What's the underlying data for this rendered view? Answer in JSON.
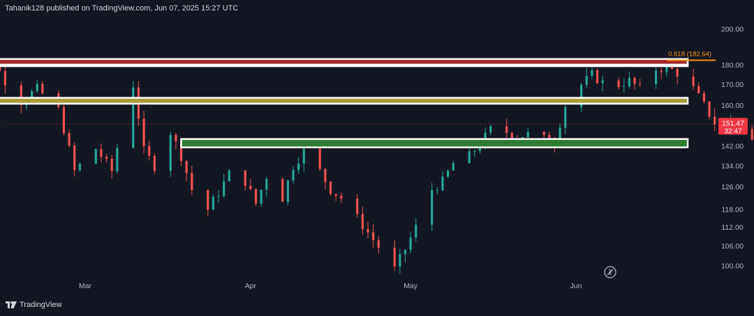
{
  "header": {
    "publisher_line": "Tahanik128 published on TradingView.com, Jun 07, 2025 15:27 UTC"
  },
  "footer": {
    "brand": "TradingView"
  },
  "colors": {
    "background": "#131722",
    "up": "#26a69a",
    "down": "#ef5350",
    "text": "#b2b5be",
    "fib": "#f7931a",
    "red_zone": "#a3282e",
    "orange_zone": "#e6a94a",
    "yellow_zone": "#a89c3a",
    "green_zone": "#2e7d32",
    "zone_border": "#ffffff",
    "price_badge": "#f23645"
  },
  "chart_data": {
    "type": "candlestick",
    "x_axis": {
      "labels": [
        {
          "label": "Mar",
          "date": "2025-03-01"
        },
        {
          "label": "Apr",
          "date": "2025-04-01"
        },
        {
          "label": "May",
          "date": "2025-05-01"
        },
        {
          "label": "Jun",
          "date": "2025-06-01"
        }
      ],
      "range": [
        "2025-02-05",
        "2025-06-06"
      ]
    },
    "y_axis": {
      "scale": "log",
      "ticks": [
        200,
        180,
        170,
        160,
        151.47,
        142,
        134,
        126,
        118,
        112,
        106,
        100
      ],
      "tick_labels": [
        "200.00",
        "180.00",
        "170.00",
        "160.00",
        "",
        "142.00",
        "134.00",
        "126.00",
        "118.00",
        "112.00",
        "106.00",
        "100.00"
      ],
      "range": [
        97,
        205
      ]
    },
    "last_price": {
      "value": 151.47,
      "label": "151.47",
      "countdown": "32:47"
    },
    "fib_level": {
      "text": "0.618 (182.64)",
      "value": 182.64,
      "start": "2025-05-28"
    },
    "zones": [
      {
        "name": "resistance-red",
        "color": "red_zone",
        "low": 180.2,
        "high": 183.3,
        "start": "2025-02-05",
        "end": "2025-06-16"
      },
      {
        "name": "resistance-orange",
        "color": "orange_zone",
        "low": 179.5,
        "high": 180.3,
        "start": "2025-02-05",
        "end": "2025-06-16"
      },
      {
        "name": "resistance-yellow",
        "color": "yellow_zone",
        "low": 160.8,
        "high": 163.6,
        "start": "2025-02-06",
        "end": "2025-06-16"
      },
      {
        "name": "support-green",
        "color": "green_zone",
        "low": 141.5,
        "high": 145.0,
        "start": "2025-03-19",
        "end": "2025-06-16"
      }
    ],
    "waypoints": [
      [
        "2025-02-05",
        205
      ],
      [
        "2025-02-07",
        196
      ],
      [
        "2025-02-11",
        186
      ],
      [
        "2025-02-14",
        172
      ],
      [
        "2025-02-17",
        162
      ],
      [
        "2025-02-20",
        168
      ],
      [
        "2025-02-24",
        158
      ],
      [
        "2025-02-27",
        132
      ],
      [
        "2025-03-03",
        141
      ],
      [
        "2025-03-06",
        132
      ],
      [
        "2025-03-10",
        170
      ],
      [
        "2025-03-12",
        140
      ],
      [
        "2025-03-14",
        134
      ],
      [
        "2025-03-17",
        148
      ],
      [
        "2025-03-19",
        138
      ],
      [
        "2025-03-21",
        125
      ],
      [
        "2025-03-24",
        118
      ],
      [
        "2025-03-26",
        124
      ],
      [
        "2025-03-28",
        131
      ],
      [
        "2025-03-31",
        128
      ],
      [
        "2025-04-02",
        120
      ],
      [
        "2025-04-04",
        130
      ],
      [
        "2025-04-07",
        122
      ],
      [
        "2025-04-09",
        134
      ],
      [
        "2025-04-11",
        140
      ],
      [
        "2025-04-14",
        132
      ],
      [
        "2025-04-16",
        125
      ],
      [
        "2025-04-18",
        122
      ],
      [
        "2025-04-21",
        115
      ],
      [
        "2025-04-24",
        108
      ],
      [
        "2025-04-28",
        99
      ],
      [
        "2025-04-30",
        105
      ],
      [
        "2025-05-02",
        112
      ],
      [
        "2025-05-05",
        125
      ],
      [
        "2025-05-07",
        128
      ],
      [
        "2025-05-09",
        135
      ],
      [
        "2025-05-12",
        138
      ],
      [
        "2025-05-14",
        143
      ],
      [
        "2025-05-16",
        149
      ],
      [
        "2025-05-19",
        148
      ],
      [
        "2025-05-21",
        146
      ],
      [
        "2025-05-23",
        147
      ],
      [
        "2025-05-26",
        145
      ],
      [
        "2025-05-28",
        144
      ],
      [
        "2025-05-30",
        160
      ],
      [
        "2025-06-02",
        170
      ],
      [
        "2025-06-04",
        175
      ],
      [
        "2025-06-06",
        171
      ],
      [
        "2025-06-09",
        170
      ],
      [
        "2025-06-11",
        172
      ],
      [
        "2025-06-13",
        168
      ],
      [
        "2025-06-16",
        178
      ],
      [
        "2025-06-18",
        179
      ],
      [
        "2025-06-20",
        176
      ],
      [
        "2025-06-23",
        168
      ],
      [
        "2025-06-25",
        160
      ],
      [
        "2025-06-27",
        152
      ],
      [
        "2025-06-30",
        153
      ],
      [
        "2025-07-02",
        150
      ],
      [
        "2025-07-03",
        149
      ],
      [
        "2025-07-04",
        144
      ],
      [
        "2025-07-07",
        148
      ],
      [
        "2025-07-09",
        151
      ]
    ]
  }
}
